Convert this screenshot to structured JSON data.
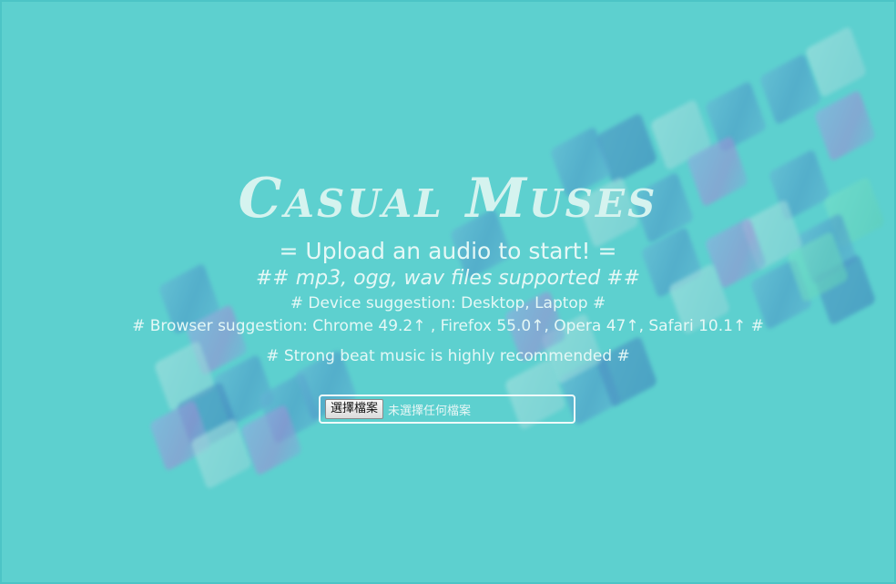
{
  "app": {
    "title": "Casual Muses",
    "upload_prompt": "= Upload an audio to start! =",
    "formats_note": "## mp3, ogg, wav files supported ##",
    "device_note": "# Device suggestion: Desktop, Laptop #",
    "browser_note": "# Browser suggestion: Chrome 49.2↑ , Firefox 55.0↑, Opera 47↑, Safari 10.1↑ #",
    "music_note": "# Strong beat music is highly recommended #"
  },
  "file_input": {
    "button_label": "選擇檔案",
    "status_text": "未選擇任何檔案"
  },
  "colors": {
    "background": "#5dd0cf",
    "text": "#e5f8f6",
    "title": "#d5f3ef"
  }
}
